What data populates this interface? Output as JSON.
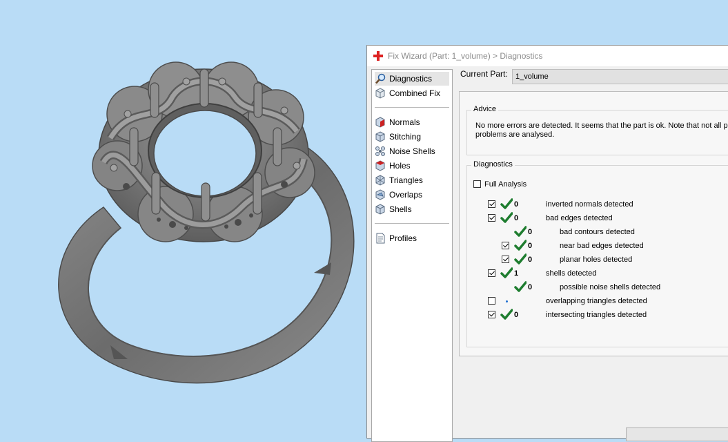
{
  "window": {
    "title": "Fix Wizard (Part: 1_volume) > Diagnostics"
  },
  "nav": {
    "top_items": [
      {
        "label": "Diagnostics",
        "icon": "magnifier-icon",
        "selected": true
      },
      {
        "label": "Combined Fix",
        "icon": "cube-icon"
      }
    ],
    "fix_items": [
      {
        "label": "Normals",
        "icon": "normals-cube-icon"
      },
      {
        "label": "Stitching",
        "icon": "stitching-cube-icon"
      },
      {
        "label": "Noise Shells",
        "icon": "noise-shells-icon"
      },
      {
        "label": "Holes",
        "icon": "holes-cube-icon"
      },
      {
        "label": "Triangles",
        "icon": "triangles-cube-icon"
      },
      {
        "label": "Overlaps",
        "icon": "overlaps-cube-icon"
      },
      {
        "label": "Shells",
        "icon": "shells-cube-icon"
      }
    ],
    "bottom_items": [
      {
        "label": "Profiles",
        "icon": "document-icon"
      }
    ]
  },
  "current_part": {
    "label": "Current Part:",
    "value": "1_volume"
  },
  "advice": {
    "title": "Advice",
    "text": "No more errors are detected. It seems that the part is ok. Note that not all possible problems are analysed."
  },
  "diagnostics": {
    "title": "Diagnostics",
    "full_analysis": {
      "label": "Full Analysis",
      "checked": false
    },
    "rows": [
      {
        "label": "inverted normals detected",
        "count": "0",
        "checked": true,
        "status": "ok",
        "level": 0
      },
      {
        "label": "bad edges detected",
        "count": "0",
        "checked": true,
        "status": "ok",
        "level": 0
      },
      {
        "label": "bad contours detected",
        "count": "0",
        "checked": null,
        "status": "ok",
        "level": 1
      },
      {
        "label": "near bad edges detected",
        "count": "0",
        "checked": true,
        "status": "ok",
        "level": 1
      },
      {
        "label": "planar holes detected",
        "count": "0",
        "checked": true,
        "status": "ok",
        "level": 1
      },
      {
        "label": "shells detected",
        "count": "1",
        "checked": true,
        "status": "ok",
        "level": 0
      },
      {
        "label": "possible noise shells detected",
        "count": "0",
        "checked": null,
        "status": "ok",
        "level": 1
      },
      {
        "label": "overlapping triangles detected",
        "count": "",
        "checked": false,
        "status": "pending",
        "level": 0
      },
      {
        "label": "intersecting triangles detected",
        "count": "0",
        "checked": true,
        "status": "ok",
        "level": 0
      }
    ]
  },
  "colors": {
    "viewport_bg": "#b9dcf6",
    "model_gray": "#7f7f7f",
    "ok_check": "#1e7d2f",
    "dialog_bg": "#f0f0f0"
  }
}
